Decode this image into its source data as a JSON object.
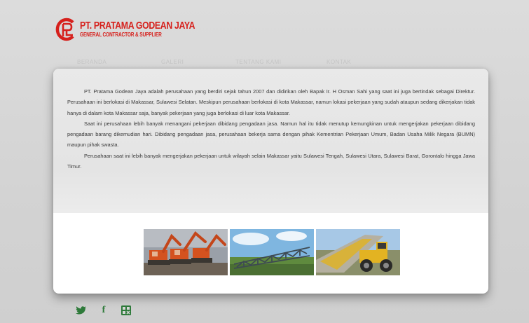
{
  "header": {
    "company_name": "PT. PRATAMA GODEAN JAYA",
    "tagline": "GENERAL CONTRACTOR & SUPPLIER"
  },
  "nav": {
    "items": [
      {
        "label": "BERANDA"
      },
      {
        "label": "GALERI"
      },
      {
        "label": "TENTANG KAMI"
      },
      {
        "label": "KONTAK"
      }
    ]
  },
  "content": {
    "paragraphs": [
      "PT. Pratama Godean Jaya adalah perusahaan yang berdiri sejak tahun 2007 dan didirikan oleh Bapak Ir. H Osman Sahi yang saat ini juga bertindak sebagai Direktur. Perusahaan ini berlokasi di Makassar, Sulawesi Selatan. Meskipun perusahaan berlokasi di kota Makassar, namun lokasi pekerjaan yang sudah ataupun sedang dikerjakan tidak hanya di dalam kota Makassar saja, banyak pekerjaan yang juga berlokasi di luar kota Makassar.",
      "Saat ini perusahaan lebih banyak menangani pekerjaan dibidang pengadaan jasa. Namun hal itu tidak menutup kemungkinan untuk mengerjakan pekerjaan dibidang pengadaan barang dikemudian hari. Dibidang pengadaan jasa, perusahaan bekerja sama dengan pihak Kementrian Pekerjaan Umum, Badan Usaha Milik Negara (BUMN) maupun pihak swasta.",
      "Perusahaan saat ini lebih banyak mengerjakan pekerjaan untuk wilayah selain Makassar yaitu Sulawesi Tengah, Sulawesi Utara, Sulawesi Barat, Gorontalo hingga Jawa Timur."
    ]
  },
  "gallery": {
    "images": [
      {
        "name": "excavators-photo"
      },
      {
        "name": "steel-bridge-photo"
      },
      {
        "name": "road-roller-photo"
      }
    ]
  },
  "social": {
    "icons": [
      "twitter-icon",
      "facebook-icon",
      "other-social-icon"
    ],
    "facebook_glyph": "f"
  },
  "colors": {
    "brand_red": "#d6201c",
    "social_green": "#2e7a3a",
    "page_bg": "#d6d6d6"
  }
}
